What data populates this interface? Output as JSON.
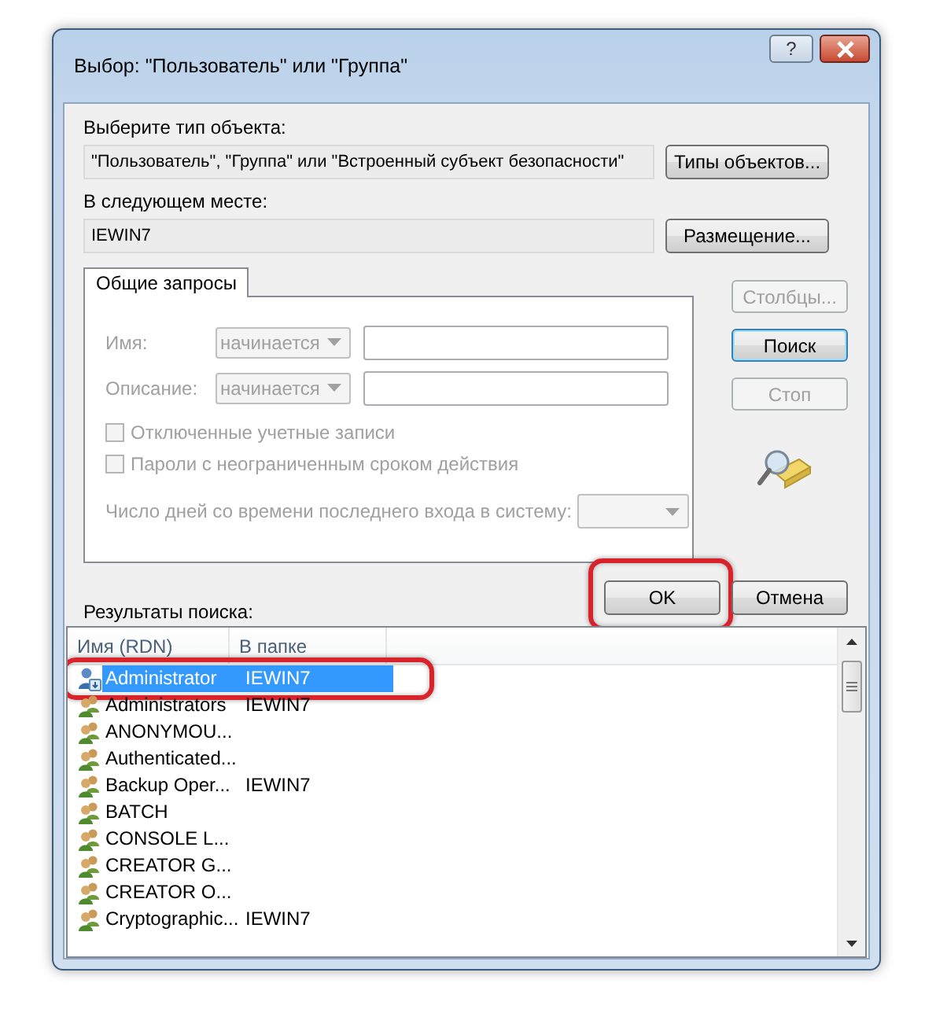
{
  "window": {
    "title": "Выбор: \"Пользователь\" или \"Группа\"",
    "help": "?"
  },
  "object_type": {
    "label": "Выберите тип объекта:",
    "value": "\"Пользователь\", \"Группа\" или \"Встроенный субъект безопасности\"",
    "button": "Типы объектов..."
  },
  "location": {
    "label": "В следующем месте:",
    "value": "IEWIN7",
    "button": "Размещение..."
  },
  "tabs": [
    {
      "label": "Общие запросы",
      "selected": true
    }
  ],
  "query": {
    "fields": [
      {
        "label": "Имя:",
        "mode": "начинается",
        "disabled": true
      },
      {
        "label": "Описание:",
        "mode": "начинается",
        "disabled": true
      }
    ],
    "checkboxes": [
      {
        "label": "Отключенные учетные записи",
        "checked": false,
        "disabled": true
      },
      {
        "label": "Пароли с неограниченным сроком действия",
        "checked": false,
        "disabled": true
      }
    ],
    "days_label": "Число дней со времени последнего входа в систему:"
  },
  "side_buttons": [
    {
      "label": "Столбцы...",
      "disabled": true,
      "default": false
    },
    {
      "label": "Поиск",
      "disabled": false,
      "default": true
    },
    {
      "label": "Стоп",
      "disabled": true,
      "default": false
    }
  ],
  "dialog_buttons": [
    {
      "label": "OK",
      "highlighted": true
    },
    {
      "label": "Отмена",
      "highlighted": false
    }
  ],
  "results": {
    "label": "Результаты поиска:",
    "columns": [
      "Имя (RDN)",
      "В папке"
    ],
    "rows": [
      {
        "kind": "user",
        "name": "Administrator",
        "folder": "IEWIN7",
        "selected": true,
        "highlighted": true
      },
      {
        "kind": "group",
        "name": "Administrators",
        "folder": "IEWIN7",
        "selected": false,
        "highlighted": false
      },
      {
        "kind": "group",
        "name": "ANONYMOU...",
        "selected": false,
        "highlighted": false
      },
      {
        "kind": "group",
        "name": "Authenticated...",
        "selected": false,
        "highlighted": false
      },
      {
        "kind": "group",
        "name": "Backup Oper...",
        "folder": "IEWIN7",
        "selected": false,
        "highlighted": false
      },
      {
        "kind": "group",
        "name": "BATCH",
        "selected": false,
        "highlighted": false
      },
      {
        "kind": "group",
        "name": "CONSOLE L...",
        "selected": false,
        "highlighted": false
      },
      {
        "kind": "group",
        "name": "CREATOR G...",
        "selected": false,
        "highlighted": false
      },
      {
        "kind": "group",
        "name": "CREATOR O...",
        "selected": false,
        "highlighted": false
      },
      {
        "kind": "group",
        "name": "Cryptographic...",
        "folder": "IEWIN7",
        "selected": false,
        "highlighted": false
      }
    ]
  }
}
